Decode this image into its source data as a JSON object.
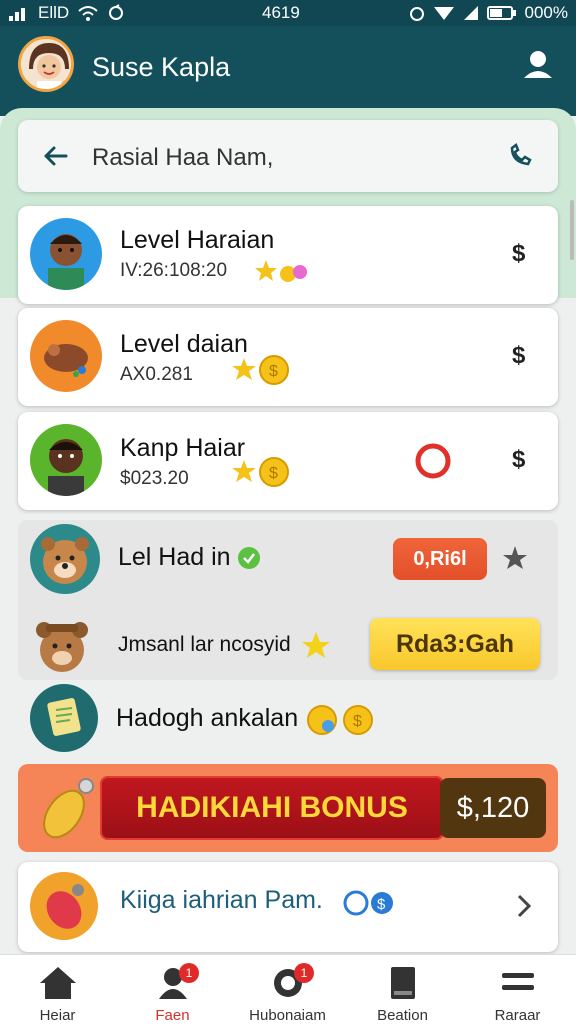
{
  "status_bar": {
    "carrier": "EllD",
    "time": "4619",
    "battery": "000%"
  },
  "header": {
    "title": "Suse Kapla",
    "avatar": "woman-avatar",
    "user_icon": "user-icon"
  },
  "search": {
    "back_icon": "arrow-left-icon",
    "text": "Rasial Haa Nam,",
    "call_icon": "phone-icon"
  },
  "rows": [
    {
      "title": "Level Haraian",
      "sub": "IV:26:108:20",
      "action": "$"
    },
    {
      "title": "Level daian",
      "sub": "AX0.281",
      "action": "$"
    },
    {
      "title": "Kanp Haiar",
      "sub": "$023.20",
      "action": "$"
    }
  ],
  "panel": {
    "row1_title": "Lel Had in",
    "row1_button": "0,Ri6l",
    "row2_title": "Jmsanl lar ncosyid",
    "row2_button": "Rda3:Gah"
  },
  "extra_row": {
    "title": "Hadogh ankalan"
  },
  "bonus": {
    "label": "HADIKIAHI BONUS",
    "amount": "$,120"
  },
  "promo": {
    "title": "Kiiga iahrian Pam."
  },
  "nav": [
    {
      "label": "Heiar",
      "icon": "home-icon",
      "badge": ""
    },
    {
      "label": "Faen",
      "icon": "person-icon",
      "badge": "1"
    },
    {
      "label": "Hubonaiam",
      "icon": "chat-icon",
      "badge": "1"
    },
    {
      "label": "Beation",
      "icon": "book-icon",
      "badge": ""
    },
    {
      "label": "Raraar",
      "icon": "menu-icon",
      "badge": ""
    }
  ],
  "colors": {
    "header": "#13505c",
    "active_nav": "#d5322b",
    "accent_orange": "#f0653a",
    "accent_yellow": "#f9c72a"
  }
}
